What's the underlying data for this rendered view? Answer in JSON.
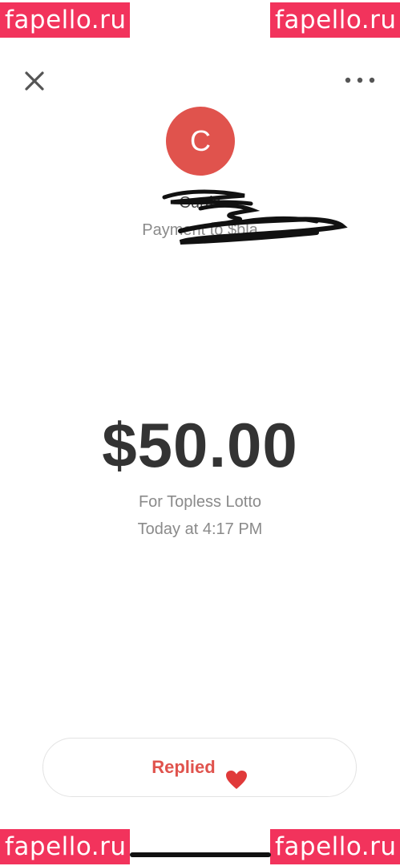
{
  "watermark": {
    "text": "fapello.ru",
    "color": "#f2335c"
  },
  "header": {
    "close_icon": "close-icon",
    "more_icon": "more-horizontal-icon"
  },
  "recipient": {
    "avatar_initial": "C",
    "avatar_color": "#e0534d",
    "name": "Curtis",
    "payment_prefix": "Payment to $bla"
  },
  "payment": {
    "amount": "$50.00",
    "note": "For Topless Lotto",
    "time": "Today at 4:17 PM"
  },
  "reply": {
    "label": "Replied",
    "emoji": "heart-icon",
    "accent": "#e0534d"
  }
}
